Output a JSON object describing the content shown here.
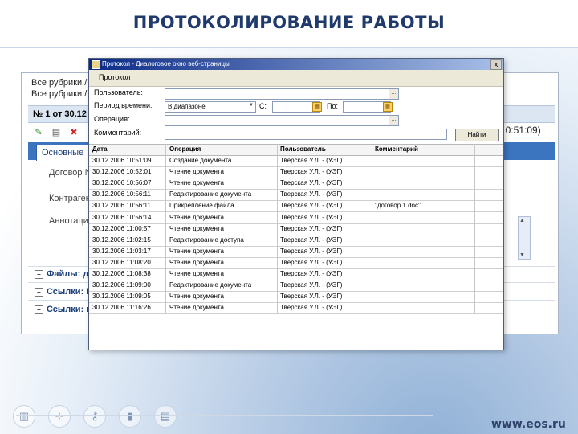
{
  "slide": {
    "title": "ПРОТОКОЛИРОВАНИЕ РАБОТЫ",
    "footer_url": "www.eos.ru",
    "footer_icons": [
      "folder-icon",
      "network-icon",
      "key-icon",
      "card-icon",
      "document-icon"
    ]
  },
  "background_window": {
    "path_line_1": "Все рубрики /",
    "path_line_2": "Все рубрики /",
    "doc_number": "№ 1 от 30.12",
    "date_right": "10:51:09)",
    "tab_label": "Основные",
    "fields": [
      "Договор №",
      "Контрагент",
      "Аннотация"
    ],
    "sections": [
      "Файлы: до",
      "Ссылки: Б",
      "Ссылки: на"
    ]
  },
  "dialog": {
    "title": "Протокол - Диалоговое окно веб-страницы",
    "close_label": "x",
    "menu_label": "Протокол",
    "filters": {
      "user_label": "Пользователь:",
      "period_label": "Период времени:",
      "period_value": "В диапазоне",
      "from_label": "С:",
      "to_label": "По:",
      "operation_label": "Операция:",
      "comment_label": "Комментарий:",
      "dots": "..."
    },
    "find_button": "Найти",
    "columns": [
      "Дата",
      "Операция",
      "Пользователь",
      "Комментарий"
    ],
    "rows": [
      [
        "30.12.2006 10:51:09",
        "Создание документа",
        "Тверская У.Л. - (УЭГ)",
        ""
      ],
      [
        "30.12.2006 10:52:01",
        "Чтение документа",
        "Тверская У.Л. - (УЭГ)",
        ""
      ],
      [
        "30.12.2006 10:56:07",
        "Чтение документа",
        "Тверская У.Л. - (УЭГ)",
        ""
      ],
      [
        "30.12.2006 10:56:11",
        "Редактирование документа",
        "Тверская У.Л. - (УЭГ)",
        ""
      ],
      [
        "30.12.2006 10:56:11",
        "Прикрепление файла",
        "Тверская У.Л. - (УЭГ)",
        "\"договор 1.doc\""
      ],
      [
        "30.12.2006 10:56:14",
        "Чтение документа",
        "Тверская У.Л. - (УЭГ)",
        ""
      ],
      [
        "30.12.2006 11:00:57",
        "Чтение документа",
        "Тверская У.Л. - (УЭГ)",
        ""
      ],
      [
        "30.12.2006 11:02:15",
        "Редактирование доступа",
        "Тверская У.Л. - (УЭГ)",
        ""
      ],
      [
        "30.12.2006 11:03:17",
        "Чтение документа",
        "Тверская У.Л. - (УЭГ)",
        ""
      ],
      [
        "30.12.2006 11:08:20",
        "Чтение документа",
        "Тверская У.Л. - (УЭГ)",
        ""
      ],
      [
        "30.12.2006 11:08:38",
        "Чтение документа",
        "Тверская У.Л. - (УЭГ)",
        ""
      ],
      [
        "30.12.2006 11:09:00",
        "Редактирование документа",
        "Тверская У.Л. - (УЭГ)",
        ""
      ],
      [
        "30.12.2006 11:09:05",
        "Чтение документа",
        "Тверская У.Л. - (УЭГ)",
        ""
      ],
      [
        "30.12.2006 11:16:26",
        "Чтение документа",
        "Тверская У.Л. - (УЭГ)",
        ""
      ]
    ]
  }
}
